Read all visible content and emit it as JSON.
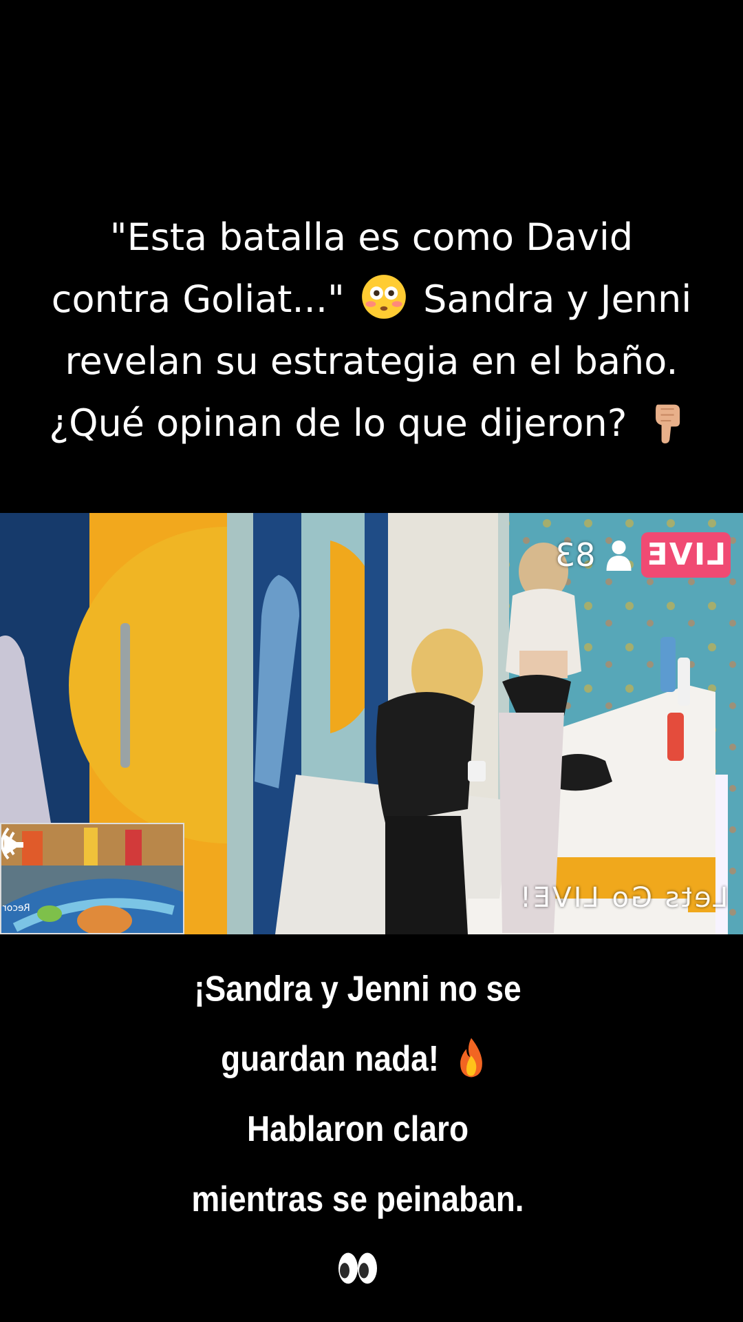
{
  "header_caption": {
    "line1": "\"Esta batalla es como David",
    "line2_part1": "contra  Goliat...\"",
    "line2_part2": "Sandra y Jenni",
    "line3": "revelan su estrategia en el baño.",
    "line4": "¿Qué opinan de lo que dijeron?",
    "emoji_1": "flushed-face-emoji",
    "emoji_2": "pointing-down-hand-emoji"
  },
  "video": {
    "live_badge": "LIVE",
    "viewer_count": "83",
    "viewer_icon": "person-icon",
    "watermark": "Lets Go LIVE!",
    "pip_label": "Recor",
    "pip_icon": "sound-icon"
  },
  "footer_caption": {
    "line1": "¡Sandra y Jenni no se",
    "line2": "guardan nada!",
    "line2_emoji": "fire-emoji",
    "line3": "Hablaron claro",
    "line4": "mientras se peinaban.",
    "line5_emoji": "eyes-emoji"
  },
  "colors": {
    "background": "#000000",
    "text": "#ffffff",
    "live_badge": "#f04a73"
  }
}
